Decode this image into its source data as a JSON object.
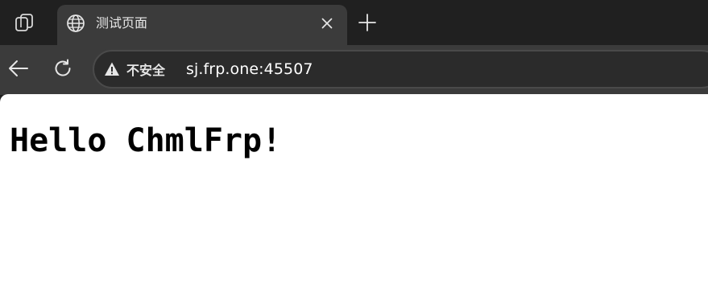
{
  "tabstrip": {
    "actions_icon": "tab-actions-icon",
    "tab": {
      "icon": "globe-icon",
      "title": "测试页面",
      "close_icon": "close-icon"
    },
    "new_tab_icon": "plus-icon"
  },
  "toolbar": {
    "back_icon": "arrow-left-icon",
    "refresh_icon": "refresh-icon",
    "omnibox": {
      "security_icon": "warning-triangle-icon",
      "security_label": "不安全",
      "url": "sj.frp.one:45507"
    }
  },
  "page": {
    "heading": "Hello ChmlFrp!"
  },
  "colors": {
    "chrome_bg": "#202020",
    "toolbar_bg": "#3b3b3b",
    "omnibox_bg": "#2b2b2b",
    "page_bg": "#ffffff",
    "text_light": "#e8e8e8"
  }
}
